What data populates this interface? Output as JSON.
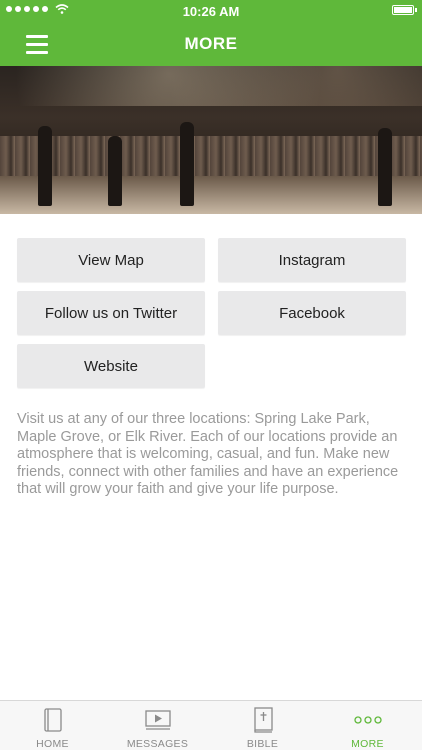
{
  "status_bar": {
    "time": "10:26 AM",
    "signal_icon": "signal-dots-icon",
    "wifi_icon": "wifi-icon",
    "battery_icon": "battery-icon"
  },
  "nav": {
    "title": "MORE",
    "menu_icon": "hamburger-menu-icon"
  },
  "hero": {
    "image": "concert-stage-photo"
  },
  "buttons": [
    {
      "label": "View Map"
    },
    {
      "label": "Instagram"
    },
    {
      "label": "Follow us on Twitter"
    },
    {
      "label": "Facebook"
    },
    {
      "label": "Website"
    }
  ],
  "description": "Visit us at any of our three locations: Spring Lake Park, Maple Grove, or Elk River. Each of our locations provide an atmosphere that is welcoming, casual, and fun. Make new friends, connect with other families and have an experience that will grow your faith and give your life purpose.",
  "tabs": [
    {
      "label": "HOME",
      "icon": "book-icon",
      "active": false
    },
    {
      "label": "MESSAGES",
      "icon": "video-play-icon",
      "active": false
    },
    {
      "label": "BIBLE",
      "icon": "bible-icon",
      "active": false
    },
    {
      "label": "MORE",
      "icon": "more-dots-icon",
      "active": true
    }
  ],
  "colors": {
    "brand_green": "#5fb83a",
    "button_bg": "#e9e9ea",
    "text_muted": "#9a9a9a"
  }
}
